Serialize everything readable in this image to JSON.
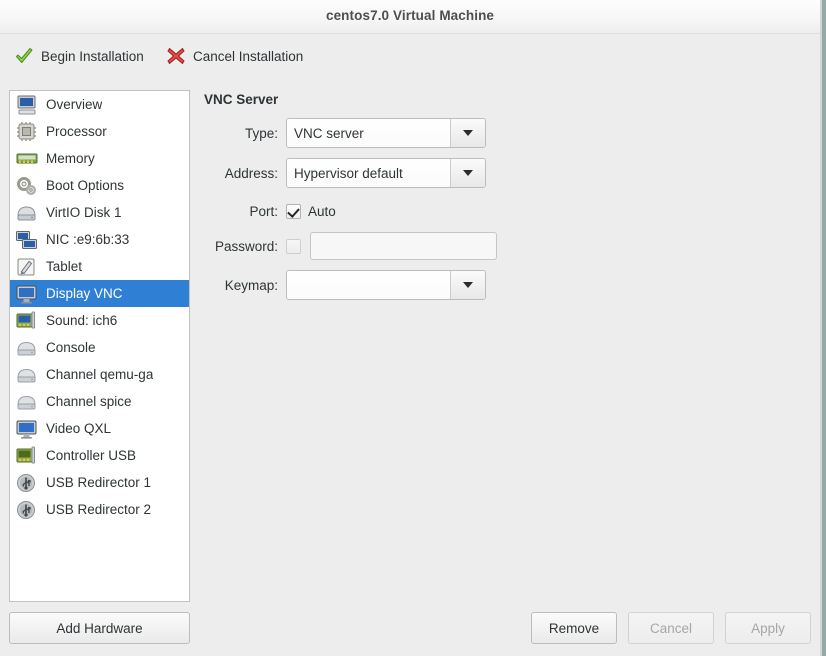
{
  "window": {
    "title": "centos7.0 Virtual Machine"
  },
  "toolbar": {
    "begin": {
      "label": "Begin Installation",
      "icon": "check-icon",
      "color": "#73c13a"
    },
    "cancel": {
      "label": "Cancel Installation",
      "icon": "x-icon",
      "color": "#cc3333"
    }
  },
  "sidebar": {
    "items": [
      {
        "label": "Overview",
        "icon": "computer-icon",
        "selected": false
      },
      {
        "label": "Processor",
        "icon": "cpu-icon",
        "selected": false
      },
      {
        "label": "Memory",
        "icon": "memory-icon",
        "selected": false
      },
      {
        "label": "Boot Options",
        "icon": "gears-icon",
        "selected": false
      },
      {
        "label": "VirtIO Disk 1",
        "icon": "harddisk-icon",
        "selected": false
      },
      {
        "label": "NIC :e9:6b:33",
        "icon": "network-icon",
        "selected": false
      },
      {
        "label": "Tablet",
        "icon": "tablet-icon",
        "selected": false
      },
      {
        "label": "Display VNC",
        "icon": "display-icon",
        "selected": true
      },
      {
        "label": "Sound: ich6",
        "icon": "soundcard-icon",
        "selected": false
      },
      {
        "label": "Console",
        "icon": "serial-icon",
        "selected": false
      },
      {
        "label": "Channel qemu-ga",
        "icon": "serial-icon",
        "selected": false
      },
      {
        "label": "Channel spice",
        "icon": "serial-icon",
        "selected": false
      },
      {
        "label": "Video QXL",
        "icon": "video-icon",
        "selected": false
      },
      {
        "label": "Controller USB",
        "icon": "controller-icon",
        "selected": false
      },
      {
        "label": "USB Redirector 1",
        "icon": "usb-icon",
        "selected": false
      },
      {
        "label": "USB Redirector 2",
        "icon": "usb-icon",
        "selected": false
      }
    ],
    "add_hardware_label": "Add Hardware"
  },
  "detail": {
    "section_title": "VNC Server",
    "type": {
      "label": "Type:",
      "value": "VNC server"
    },
    "address": {
      "label": "Address:",
      "value": "Hypervisor default"
    },
    "port": {
      "label": "Port:",
      "auto_label": "Auto",
      "auto_checked": true
    },
    "password": {
      "label": "Password:",
      "value": "",
      "enabled": false
    },
    "keymap": {
      "label": "Keymap:",
      "value": ""
    }
  },
  "footer": {
    "remove": {
      "label": "Remove",
      "enabled": true
    },
    "cancel": {
      "label": "Cancel",
      "enabled": false
    },
    "apply": {
      "label": "Apply",
      "enabled": false
    }
  },
  "colors": {
    "selection": "#2f7fd4",
    "window_bg": "#ededed",
    "desktop_bg": "#8fa8a8"
  }
}
